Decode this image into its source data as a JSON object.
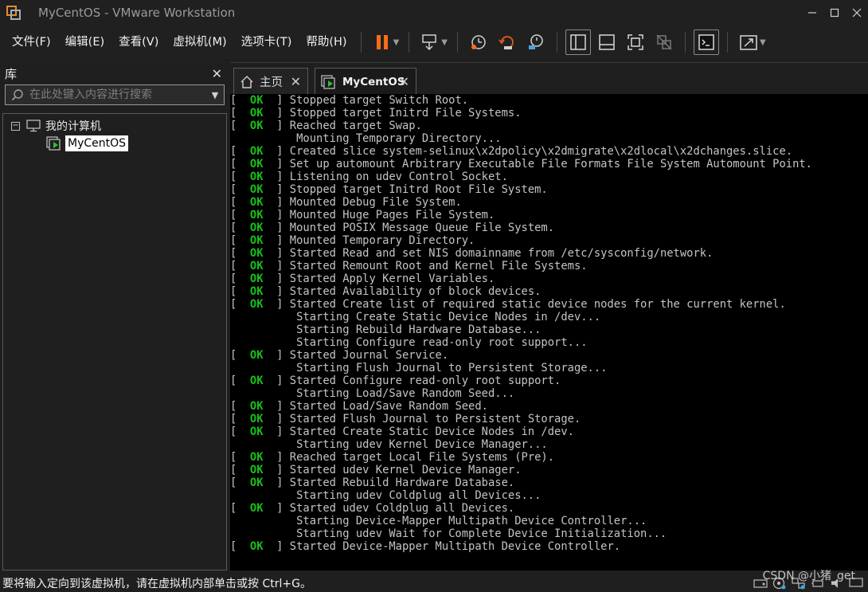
{
  "window": {
    "title": "MyCentOS - VMware Workstation",
    "controls": [
      "—",
      "☐",
      "✕"
    ]
  },
  "menu": {
    "items": [
      "文件(F)",
      "编辑(E)",
      "查看(V)",
      "虚拟机(M)",
      "选项卡(T)",
      "帮助(H)"
    ]
  },
  "toolbar": {
    "buttons": [
      {
        "name": "pause-icon",
        "color": "#ff6a1a"
      },
      {
        "name": "send-ctrl-alt-del-icon"
      },
      {
        "name": "snapshot-icon"
      },
      {
        "name": "revert-snapshot-icon"
      },
      {
        "name": "snapshot-manager-icon"
      },
      {
        "name": "show-library-icon"
      },
      {
        "name": "thumbnail-bar-icon"
      },
      {
        "name": "full-screen-icon"
      },
      {
        "name": "unity-icon"
      },
      {
        "name": "console-view-icon"
      },
      {
        "name": "stretch-guest-icon"
      }
    ]
  },
  "library": {
    "title": "库",
    "close": "✕",
    "search_placeholder": "在此处键入内容进行搜索",
    "tree": {
      "root_toggle": "−",
      "root_label": "我的计算机",
      "vm_label": "MyCentOS"
    }
  },
  "tabs": [
    {
      "label": "主页",
      "close": "✕"
    },
    {
      "label": "MyCentOS",
      "close": "✕"
    }
  ],
  "console": {
    "ok_text": "OK",
    "lines": [
      {
        "ok": true,
        "text": "Stopped target Switch Root."
      },
      {
        "ok": true,
        "text": "Stopped target Initrd File Systems."
      },
      {
        "ok": true,
        "text": "Reached target Swap."
      },
      {
        "ok": false,
        "text": "Mounting Temporary Directory..."
      },
      {
        "ok": true,
        "text": "Created slice system-selinux\\x2dpolicy\\x2dmigrate\\x2dlocal\\x2dchanges.slice."
      },
      {
        "ok": true,
        "text": "Set up automount Arbitrary Executable File Formats File System Automount Point."
      },
      {
        "ok": true,
        "text": "Listening on udev Control Socket."
      },
      {
        "ok": true,
        "text": "Stopped target Initrd Root File System."
      },
      {
        "ok": true,
        "text": "Mounted Debug File System."
      },
      {
        "ok": true,
        "text": "Mounted Huge Pages File System."
      },
      {
        "ok": true,
        "text": "Mounted POSIX Message Queue File System."
      },
      {
        "ok": true,
        "text": "Mounted Temporary Directory."
      },
      {
        "ok": true,
        "text": "Started Read and set NIS domainname from /etc/sysconfig/network."
      },
      {
        "ok": true,
        "text": "Started Remount Root and Kernel File Systems."
      },
      {
        "ok": true,
        "text": "Started Apply Kernel Variables."
      },
      {
        "ok": true,
        "text": "Started Availability of block devices."
      },
      {
        "ok": true,
        "text": "Started Create list of required static device nodes for the current kernel."
      },
      {
        "ok": false,
        "text": "Starting Create Static Device Nodes in /dev..."
      },
      {
        "ok": false,
        "text": "Starting Rebuild Hardware Database..."
      },
      {
        "ok": false,
        "text": "Starting Configure read-only root support..."
      },
      {
        "ok": true,
        "text": "Started Journal Service."
      },
      {
        "ok": false,
        "text": "Starting Flush Journal to Persistent Storage..."
      },
      {
        "ok": true,
        "text": "Started Configure read-only root support."
      },
      {
        "ok": false,
        "text": "Starting Load/Save Random Seed..."
      },
      {
        "ok": true,
        "text": "Started Load/Save Random Seed."
      },
      {
        "ok": true,
        "text": "Started Flush Journal to Persistent Storage."
      },
      {
        "ok": true,
        "text": "Started Create Static Device Nodes in /dev."
      },
      {
        "ok": false,
        "text": "Starting udev Kernel Device Manager..."
      },
      {
        "ok": true,
        "text": "Reached target Local File Systems (Pre)."
      },
      {
        "ok": true,
        "text": "Started udev Kernel Device Manager."
      },
      {
        "ok": true,
        "text": "Started Rebuild Hardware Database."
      },
      {
        "ok": false,
        "text": "Starting udev Coldplug all Devices..."
      },
      {
        "ok": true,
        "text": "Started udev Coldplug all Devices."
      },
      {
        "ok": false,
        "text": "Starting Device-Mapper Multipath Device Controller..."
      },
      {
        "ok": false,
        "text": "Starting udev Wait for Complete Device Initialization..."
      },
      {
        "ok": true,
        "text": "Started Device-Mapper Multipath Device Controller."
      }
    ]
  },
  "status": {
    "message": "要将输入定向到该虚拟机，请在虚拟机内部单击或按 Ctrl+G。",
    "watermark": "CSDN @小猪_get"
  }
}
